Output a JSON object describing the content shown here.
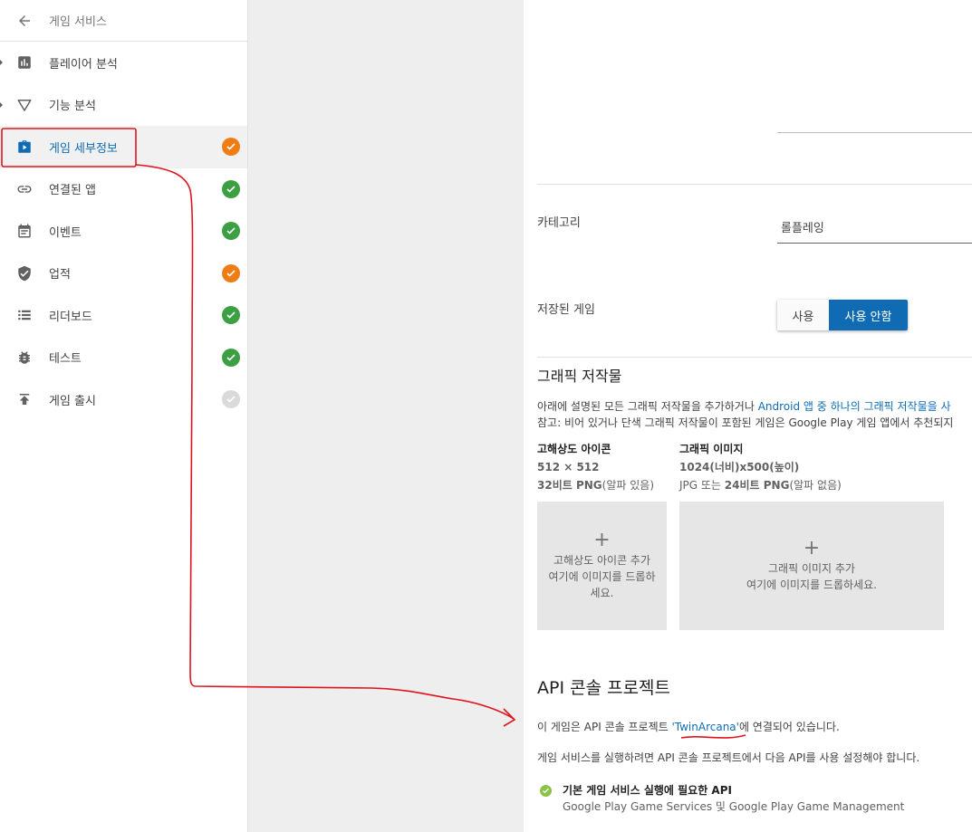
{
  "sidebar": {
    "back_label": "게임 서비스",
    "items": [
      {
        "label": "플레이어 분석",
        "icon": "bar-chart-icon",
        "status": "none"
      },
      {
        "label": "기능 분석",
        "icon": "triangle-filter-icon",
        "status": "none"
      },
      {
        "label": "게임 세부정보",
        "icon": "play-briefcase-icon",
        "status": "warning"
      },
      {
        "label": "연결된 앱",
        "icon": "link-icon",
        "status": "ok"
      },
      {
        "label": "이벤트",
        "icon": "calendar-icon",
        "status": "ok"
      },
      {
        "label": "업적",
        "icon": "shield-check-icon",
        "status": "warning"
      },
      {
        "label": "리더보드",
        "icon": "list-icon",
        "status": "ok"
      },
      {
        "label": "테스트",
        "icon": "bug-icon",
        "status": "ok"
      },
      {
        "label": "게임 출시",
        "icon": "publish-icon",
        "status": "disabled"
      }
    ]
  },
  "details": {
    "category_label": "카테고리",
    "category_value": "롤플레잉",
    "saved_games_label": "저장된 게임",
    "saved_games_on": "사용",
    "saved_games_off": "사용 안함",
    "graphics_title": "그래픽 저작물",
    "graphics_desc_1a": "아래에 설명된 모든 그래픽 저작물을 추가하거나 ",
    "graphics_desc_1b": "Android 앱 중 하나의 그래픽 저작물을 사",
    "graphics_desc_2": "참고: 비어 있거나 단색 그래픽 저작물이 포함된 게임은 Google Play 게임 앱에서 추천되지",
    "hires_icon": {
      "title": "고해상도 아이콘",
      "size": "512 × 512",
      "format_bold": "32비트 PNG",
      "format_rest": "(알파 있음)"
    },
    "graphic_image": {
      "title": "그래픽 이미지",
      "size": "1024(너비)x500(높이)",
      "format_a": "JPG 또는 ",
      "format_bold": "24비트 PNG",
      "format_rest": "(알파 없음)"
    },
    "icon_drop": {
      "line1": "고해상도 아이콘 추가",
      "line2": "여기에 이미지를 드롭하",
      "line3": "세요."
    },
    "image_drop": {
      "line1": "그래픽 이미지 추가",
      "line2": "여기에 이미지를 드롭하세요."
    }
  },
  "api": {
    "title": "API 콘솔 프로젝트",
    "linked_pre": "이 게임은 API 콘솔 프로젝트 ",
    "project_name": "'TwinArcana'",
    "linked_post": "에 연결되어 있습니다.",
    "instruction": "게임 서비스를 실행하려면 API 콘솔 프로젝트에서 다음 API를 사용 설정해야 합니다.",
    "required_title": "기본 게임 서비스 실행에 필요한 API",
    "required_apis": "Google Play Game Services 및 Google Play Game Management"
  },
  "colors": {
    "accent": "#0f6cb4",
    "ok": "#3c9f43",
    "warning": "#ef7d16",
    "annotation": "#e0141e"
  }
}
